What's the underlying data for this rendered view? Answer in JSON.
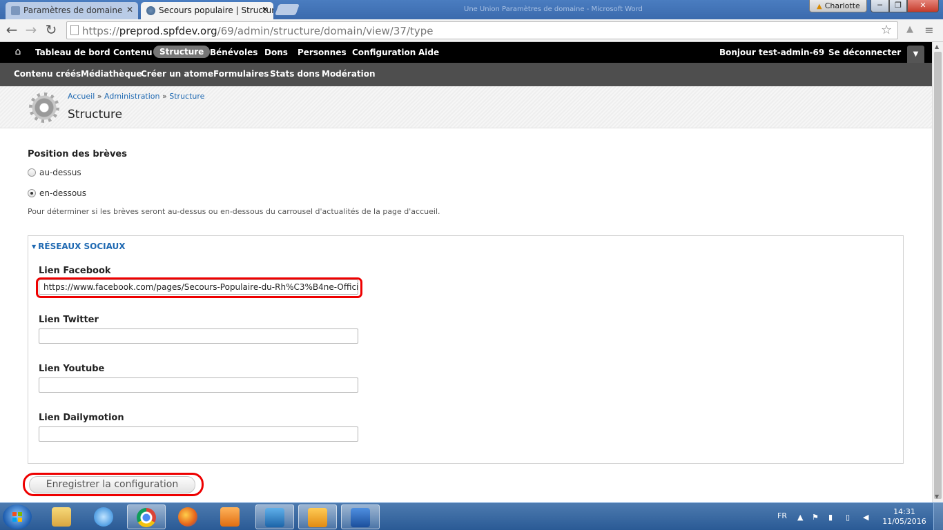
{
  "browser": {
    "tabs": [
      {
        "title": "Paramètres de domaine"
      },
      {
        "title": "Secours populaire | Structure"
      }
    ],
    "window_title": "Une Union Paramètres de domaine - Microsoft Word",
    "user_chip": "Charlotte",
    "url_scheme": "https://",
    "url_host": "preprod.spfdev.org",
    "url_path": "/69/admin/structure/domain/view/37/type"
  },
  "admin_menu": {
    "items": [
      "Tableau de bord",
      "Contenu",
      "Structure",
      "Bénévoles",
      "Dons",
      "Personnes",
      "Configuration",
      "Aide"
    ],
    "active": "Structure",
    "greeting": "Bonjour",
    "username": "test-admin-69",
    "logout": "Se déconnecter"
  },
  "shortcuts": [
    "Contenu créés",
    "Médiathèque",
    "Créer un atome",
    "Formulaires",
    "Stats dons",
    "Modération"
  ],
  "page": {
    "breadcrumb": [
      "Accueil",
      "Administration",
      "Structure"
    ],
    "breadcrumb_sep": "»",
    "title": "Structure"
  },
  "form": {
    "position_label": "Position des brèves",
    "radio_above": "au-dessus",
    "radio_below": "en-dessous",
    "selected": "en-dessous",
    "help_text": "Pour déterminer si les brèves seront au-dessus ou en-dessous du carrousel d'actualités de la page d'accueil.",
    "fieldset_title": "RÉSEAUX SOCIAUX",
    "facebook_label": "Lien Facebook",
    "facebook_value": "https://www.facebook.com/pages/Secours-Populaire-du-Rh%C3%B4ne-Offici",
    "twitter_label": "Lien Twitter",
    "twitter_value": "",
    "youtube_label": "Lien Youtube",
    "youtube_value": "",
    "dailymotion_label": "Lien Dailymotion",
    "dailymotion_value": "",
    "save_label": "Enregistrer la configuration"
  },
  "taskbar": {
    "language": "FR",
    "time": "14:31",
    "date": "11/05/2016"
  },
  "colors": {
    "link": "#1f69b2",
    "highlight": "#e00000",
    "admin_bar": "#000000",
    "shortcut_bar": "#4e4e4e"
  }
}
